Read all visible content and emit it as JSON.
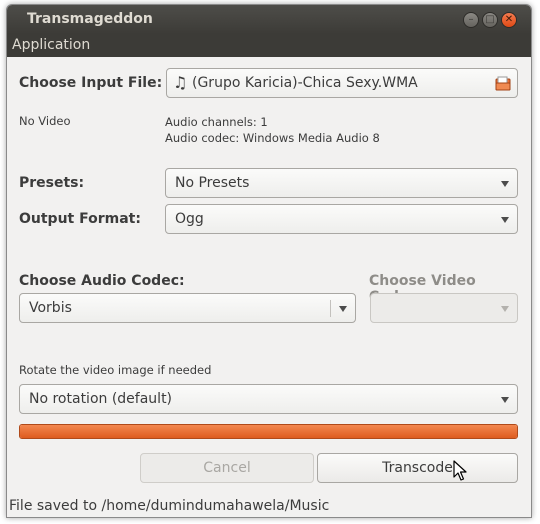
{
  "window": {
    "title": "Transmageddon"
  },
  "titlebar_buttons": {
    "minimize_icon": "minimize-icon",
    "maximize_icon": "maximize-icon",
    "close_icon": "close-icon"
  },
  "menubar": {
    "application": "Application"
  },
  "input": {
    "label": "Choose Input File:",
    "file": "(Grupo Karicia)-Chica Sexy.WMA",
    "file_icon": "music-note-icon",
    "open_icon": "file-open-icon"
  },
  "info": {
    "video": "No Video",
    "audio_channels": "Audio channels: 1",
    "audio_codec": "Audio codec: Windows Media Audio 8"
  },
  "presets": {
    "label": "Presets:",
    "value": "No Presets"
  },
  "output_format": {
    "label": "Output Format:",
    "value": "Ogg"
  },
  "audio_codec": {
    "label": "Choose Audio Codec:",
    "value": "Vorbis"
  },
  "video_codec": {
    "label": "Choose Video Codec:",
    "value": ""
  },
  "rotation": {
    "label": "Rotate the video image if needed",
    "value": "No rotation (default)"
  },
  "progress": {
    "fraction": 1.0,
    "color": "#e4652a"
  },
  "buttons": {
    "cancel": "Cancel",
    "transcode": "Transcode"
  },
  "status": {
    "text": "File saved to /home/dumindumahawela/Music"
  },
  "colors": {
    "titlebar": "#3c3b37",
    "accent": "#e4652a",
    "background": "#f2f1f0"
  }
}
